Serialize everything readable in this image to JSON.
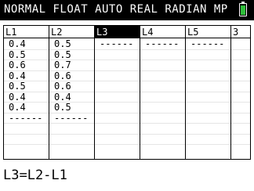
{
  "status_bar": {
    "text": "NORMAL FLOAT AUTO REAL RADIAN MP",
    "battery_color": "#2fbf3a"
  },
  "list_editor": {
    "columns": [
      {
        "header": "L1",
        "active": false,
        "values": [
          "0.4",
          "0.5",
          "0.6",
          "0.4",
          "0.5",
          "0.4",
          "0.4",
          "------"
        ]
      },
      {
        "header": "L2",
        "active": false,
        "values": [
          "0.5",
          "0.5",
          "0.7",
          "0.6",
          "0.6",
          "0.4",
          "0.5",
          "------"
        ]
      },
      {
        "header": "L3",
        "active": true,
        "values": [
          "------"
        ]
      },
      {
        "header": "L4",
        "active": false,
        "values": [
          "------"
        ]
      },
      {
        "header": "L5",
        "active": false,
        "values": [
          "------"
        ]
      },
      {
        "header": "3",
        "active": false,
        "values": []
      }
    ]
  },
  "entry_line": {
    "text": "L3=L2-L1"
  }
}
